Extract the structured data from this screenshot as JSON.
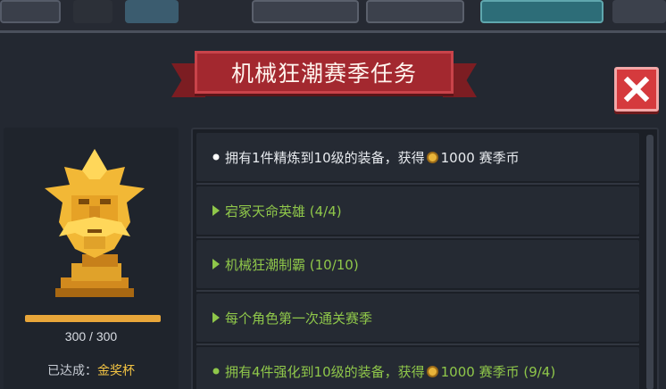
{
  "colors": {
    "banner": "#a3282f",
    "close_button": "#d53a3d",
    "quest_done_text": "#e8ebef",
    "quest_text": "#8fc74a",
    "achievement_value": "#f2c343",
    "progress_fill": "#e8a63a"
  },
  "title": "机械狂潮赛季任务",
  "trophy": {
    "icon": "golden-trophy-head-icon",
    "progress": {
      "current": 300,
      "max": 300,
      "fraction": 1.0
    },
    "progress_text": "300 / 300",
    "achieved_label": "已达成：",
    "achieved_value": "金奖杯"
  },
  "quests": [
    {
      "state": "completed",
      "bullet": "dot",
      "text_before": "拥有1件精炼到10级的装备，获得",
      "reward_icon": "coin-icon",
      "text_after": "1000 赛季币"
    },
    {
      "state": "active",
      "bullet": "arrow",
      "text": "宕冢天命英雄 (4/4)"
    },
    {
      "state": "active",
      "bullet": "arrow",
      "text": "机械狂潮制霸 (10/10)"
    },
    {
      "state": "active",
      "bullet": "arrow",
      "text": "每个角色第一次通关赛季"
    },
    {
      "state": "claimable",
      "bullet": "dot",
      "text_before": "拥有4件强化到10级的装备，获得",
      "reward_icon": "coin-icon",
      "text_after": "1000 赛季币 (9/4)"
    }
  ]
}
